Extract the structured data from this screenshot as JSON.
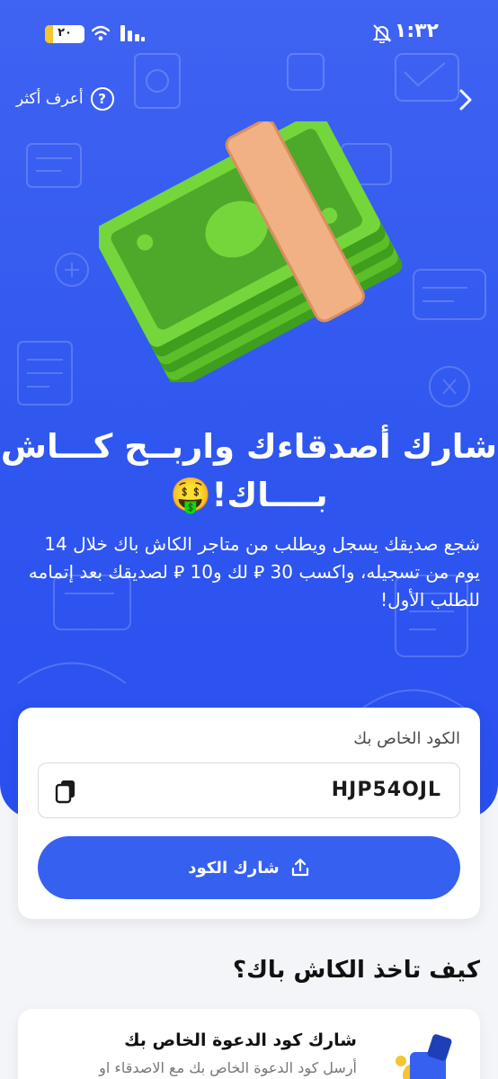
{
  "status_bar": {
    "time": "١:٣٢",
    "battery": "٢٠",
    "battery_level": 0.2
  },
  "nav": {
    "learn_more": "أعرف أكثر",
    "help_icon": "?"
  },
  "hero": {
    "headline_line1": "شارك أصدقاءك  واربــح كـــاش",
    "headline_line2": "بــــاك!🤑",
    "description": "شجع صديقك يسجل ويطلب من متاجر الكاش باك خلال 14 يوم من تسجيله، واكسب 30 ⃁ لك و10 ⃁ لصديقك بعد إتمامه للطلب الأول!"
  },
  "code_card": {
    "label": "الكود الخاص بك",
    "code": "HJP54OJL",
    "share_button": "شارك الكود"
  },
  "how": {
    "title": "كيف تاخذ الكاش باك؟",
    "steps": [
      {
        "title": "شارك كود الدعوة الخاص بك",
        "desc": "أرسل كود الدعوة الخاص بك مع الاصدقاء او"
      }
    ]
  },
  "colors": {
    "hero_blue": "#3560f0",
    "button_blue": "#3560f0",
    "battery_yellow": "#f5c431"
  },
  "icons": [
    "bell-off-icon",
    "wifi-icon",
    "signal-icon",
    "battery-icon",
    "help-icon",
    "chevron-right-icon",
    "copy-icon",
    "share-icon"
  ]
}
